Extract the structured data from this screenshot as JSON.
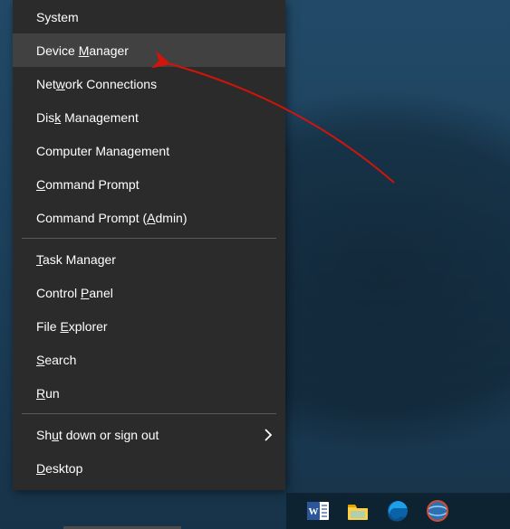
{
  "menu": {
    "groups": [
      [
        {
          "pre": "",
          "mn": "",
          "post": "System"
        },
        {
          "pre": "Device ",
          "mn": "M",
          "post": "anager",
          "highlight": true
        },
        {
          "pre": "Net",
          "mn": "w",
          "post": "ork Connections"
        },
        {
          "pre": "Dis",
          "mn": "k",
          "post": " Management"
        },
        {
          "pre": "Computer Mana",
          "mn": "g",
          "post": "ement"
        },
        {
          "pre": "",
          "mn": "C",
          "post": "ommand Prompt"
        },
        {
          "pre": "Command Prompt (",
          "mn": "A",
          "post": "dmin)"
        }
      ],
      [
        {
          "pre": "",
          "mn": "T",
          "post": "ask Manager"
        },
        {
          "pre": "Control ",
          "mn": "P",
          "post": "anel"
        },
        {
          "pre": "File ",
          "mn": "E",
          "post": "xplorer"
        },
        {
          "pre": "",
          "mn": "S",
          "post": "earch"
        },
        {
          "pre": "",
          "mn": "R",
          "post": "un"
        }
      ],
      [
        {
          "pre": "Sh",
          "mn": "u",
          "post": "t down or sign out",
          "arrow": true
        },
        {
          "pre": "",
          "mn": "D",
          "post": "esktop"
        }
      ]
    ]
  },
  "taskbar": {
    "icons": [
      "word-icon",
      "file-explorer-icon",
      "edge-icon",
      "globe-app-icon"
    ]
  },
  "annotation": {
    "arrow_color": "#d2140b"
  }
}
